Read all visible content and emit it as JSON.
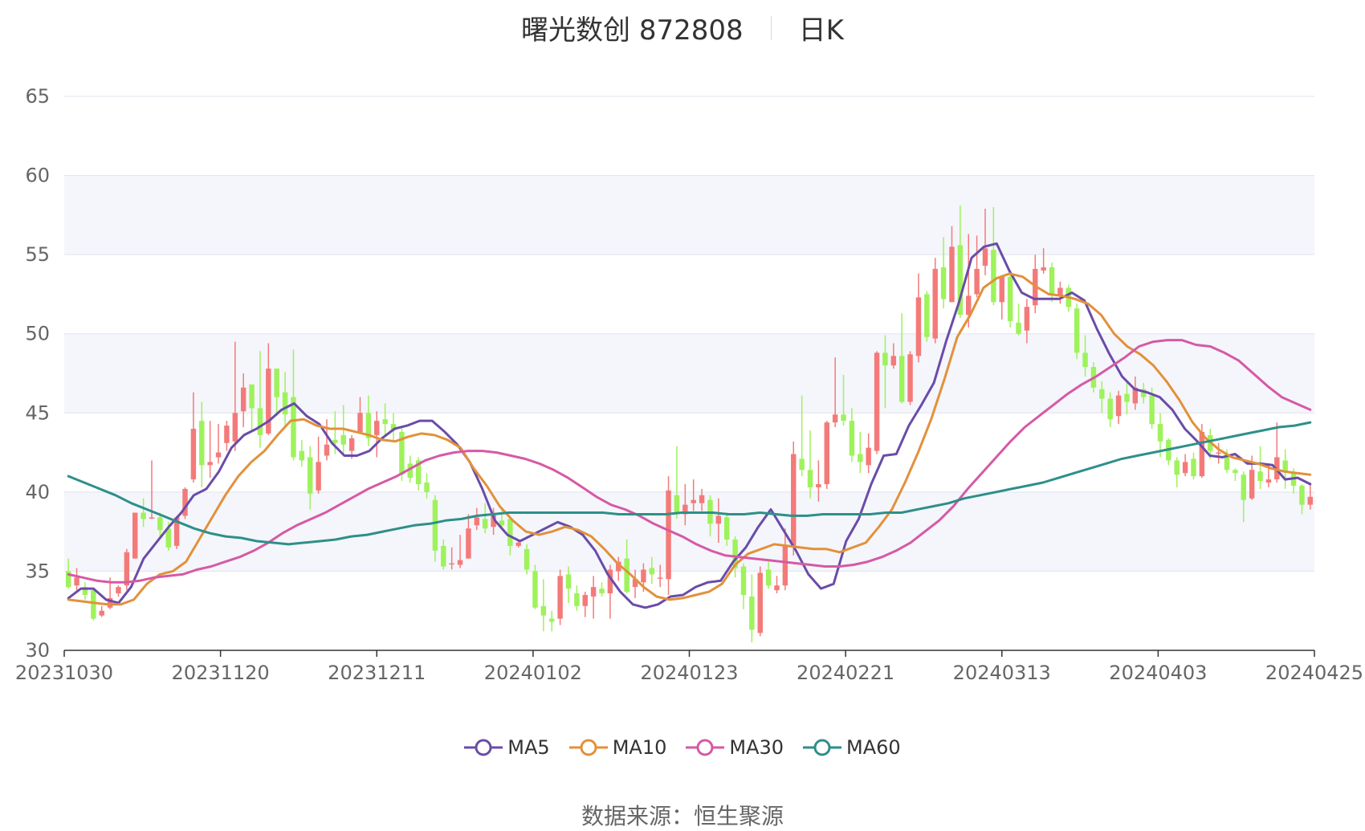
{
  "title": {
    "name": "曙光数创 872808",
    "period": "日K"
  },
  "source": {
    "label": "数据来源：",
    "value": "恒生聚源"
  },
  "colors": {
    "up": "#f47a7a",
    "down": "#9ef25b",
    "MA5": "#6a4ca8",
    "MA10": "#e2913b",
    "MA30": "#d659a5",
    "MA60": "#2e8f8a",
    "band": "#f4f6fb",
    "grid": "#dfe3ee"
  },
  "chart_data": {
    "type": "candlestick",
    "x_ticks": [
      "20231030",
      "20231120",
      "20231211",
      "20240102",
      "20240123",
      "20240221",
      "20240313",
      "20240403",
      "20240425"
    ],
    "ylim": [
      30,
      65
    ],
    "y_ticks": [
      30,
      35,
      40,
      45,
      50,
      55,
      60,
      65
    ],
    "grid": true,
    "legend_position": "bottom",
    "series": [
      {
        "name": "MA5",
        "color": "#6a4ca8",
        "values": [
          33.3,
          33.9,
          33.9,
          33.2,
          33.0,
          34.0,
          35.8,
          36.8,
          37.8,
          38.7,
          39.8,
          40.2,
          41.3,
          42.8,
          43.6,
          44.0,
          44.5,
          45.2,
          45.6,
          44.8,
          44.3,
          43.1,
          42.3,
          42.3,
          42.6,
          43.4,
          44.0,
          44.2,
          44.5,
          44.5,
          43.8,
          43.0,
          41.9,
          40.2,
          38.2,
          37.3,
          36.9,
          37.3,
          37.7,
          38.1,
          37.8,
          37.3,
          36.3,
          34.8,
          33.7,
          32.9,
          32.7,
          32.9,
          33.4,
          33.5,
          34.0,
          34.3,
          34.4,
          35.6,
          36.5,
          37.8,
          38.9,
          37.6,
          36.3,
          34.8,
          33.9,
          34.2,
          36.9,
          38.3,
          40.5,
          42.3,
          42.4,
          44.2,
          45.5,
          46.9,
          49.6,
          52.0,
          54.8,
          55.5,
          55.7,
          54.0,
          52.6,
          52.2,
          52.2,
          52.2,
          52.6,
          52.1,
          50.3,
          48.7,
          47.3,
          46.5,
          46.3,
          46.0,
          45.2,
          44.0,
          43.2,
          42.3,
          42.2,
          42.4,
          41.8,
          41.8,
          41.7,
          40.8,
          40.9,
          40.5
        ]
      },
      {
        "name": "MA10",
        "color": "#e2913b",
        "values": [
          33.2,
          33.1,
          33.0,
          32.9,
          32.9,
          33.2,
          34.2,
          34.8,
          35.0,
          35.6,
          37.0,
          38.4,
          39.8,
          41.0,
          41.9,
          42.6,
          43.6,
          44.5,
          44.6,
          44.2,
          44.0,
          44.0,
          43.8,
          43.6,
          43.3,
          43.2,
          43.5,
          43.7,
          43.6,
          43.3,
          42.8,
          41.5,
          40.4,
          39.1,
          38.2,
          37.5,
          37.3,
          37.5,
          37.8,
          37.6,
          37.2,
          36.4,
          35.5,
          34.8,
          34.0,
          33.4,
          33.2,
          33.3,
          33.5,
          33.7,
          34.2,
          35.4,
          36.1,
          36.4,
          36.7,
          36.6,
          36.5,
          36.4,
          36.4,
          36.2,
          36.5,
          36.8,
          37.8,
          38.9,
          40.6,
          42.5,
          44.6,
          47.1,
          49.8,
          51.2,
          52.9,
          53.5,
          53.8,
          53.6,
          53.0,
          52.5,
          52.4,
          52.2,
          51.9,
          51.2,
          50.0,
          49.2,
          48.7,
          48.0,
          47.0,
          45.8,
          44.4,
          43.4,
          42.7,
          42.2,
          42.0,
          41.8,
          41.5,
          41.3,
          41.2,
          41.1
        ]
      },
      {
        "name": "MA30",
        "color": "#d659a5",
        "values": [
          34.8,
          34.6,
          34.4,
          34.3,
          34.3,
          34.4,
          34.6,
          34.7,
          34.8,
          35.1,
          35.3,
          35.6,
          35.9,
          36.3,
          36.8,
          37.4,
          37.9,
          38.3,
          38.7,
          39.2,
          39.7,
          40.2,
          40.6,
          41.0,
          41.5,
          42.0,
          42.3,
          42.5,
          42.6,
          42.6,
          42.5,
          42.3,
          42.1,
          41.8,
          41.4,
          40.9,
          40.3,
          39.7,
          39.2,
          38.9,
          38.5,
          38.0,
          37.6,
          37.2,
          36.7,
          36.3,
          36.0,
          35.9,
          35.8,
          35.7,
          35.6,
          35.5,
          35.4,
          35.3,
          35.3,
          35.4,
          35.6,
          35.9,
          36.3,
          36.8,
          37.5,
          38.2,
          39.1,
          40.2,
          41.2,
          42.2,
          43.2,
          44.1,
          44.8,
          45.5,
          46.2,
          46.8,
          47.3,
          47.9,
          48.5,
          49.2,
          49.5,
          49.6,
          49.6,
          49.3,
          49.2,
          48.8,
          48.3,
          47.5,
          46.7,
          46.0,
          45.6,
          45.2
        ]
      },
      {
        "name": "MA60",
        "color": "#2e8f8a",
        "values": [
          41.0,
          40.6,
          40.2,
          39.8,
          39.3,
          38.9,
          38.5,
          38.1,
          37.7,
          37.4,
          37.2,
          37.1,
          36.9,
          36.8,
          36.7,
          36.8,
          36.9,
          37.0,
          37.2,
          37.3,
          37.5,
          37.7,
          37.9,
          38.0,
          38.2,
          38.3,
          38.5,
          38.6,
          38.7,
          38.7,
          38.7,
          38.7,
          38.7,
          38.7,
          38.7,
          38.6,
          38.6,
          38.6,
          38.6,
          38.7,
          38.7,
          38.7,
          38.6,
          38.6,
          38.7,
          38.6,
          38.5,
          38.5,
          38.6,
          38.6,
          38.6,
          38.6,
          38.7,
          38.7,
          38.9,
          39.1,
          39.3,
          39.6,
          39.8,
          40.0,
          40.2,
          40.4,
          40.6,
          40.9,
          41.2,
          41.5,
          41.8,
          42.1,
          42.3,
          42.5,
          42.7,
          42.9,
          43.1,
          43.3,
          43.5,
          43.7,
          43.9,
          44.1,
          44.2,
          44.4
        ]
      }
    ],
    "candles": [
      [
        35.0,
        34.0,
        35.8,
        33.9
      ],
      [
        34.1,
        34.6,
        35.2,
        33.8
      ],
      [
        34.0,
        33.5,
        34.3,
        33.2
      ],
      [
        33.8,
        32.0,
        33.9,
        31.9
      ],
      [
        32.2,
        32.5,
        32.8,
        32.1
      ],
      [
        32.7,
        33.3,
        34.6,
        32.6
      ],
      [
        33.6,
        34.0,
        34.1,
        33.4
      ],
      [
        34.1,
        36.2,
        36.4,
        33.8
      ],
      [
        35.8,
        38.7,
        38.7,
        35.8
      ],
      [
        38.7,
        38.3,
        39.6,
        37.8
      ],
      [
        38.4,
        38.4,
        42.0,
        38.3
      ],
      [
        38.4,
        37.6,
        38.7,
        37.1
      ],
      [
        37.7,
        36.5,
        38.1,
        36.3
      ],
      [
        36.6,
        38.4,
        38.5,
        36.4
      ],
      [
        38.5,
        40.2,
        40.3,
        38.3
      ],
      [
        40.8,
        44.0,
        46.3,
        40.6
      ],
      [
        44.5,
        41.7,
        45.7,
        40.3
      ],
      [
        41.7,
        41.9,
        44.5,
        40.9
      ],
      [
        42.2,
        42.5,
        44.3,
        41.8
      ],
      [
        43.1,
        44.2,
        44.5,
        42.6
      ],
      [
        43.2,
        45.0,
        49.5,
        42.6
      ],
      [
        45.1,
        46.6,
        47.5,
        44.1
      ],
      [
        46.8,
        45.3,
        46.8,
        43.8
      ],
      [
        45.3,
        43.6,
        48.9,
        42.8
      ],
      [
        43.7,
        47.8,
        49.4,
        43.6
      ],
      [
        47.8,
        46.0,
        47.8,
        44.8
      ],
      [
        46.3,
        44.9,
        47.6,
        44.1
      ],
      [
        46.0,
        42.2,
        49.0,
        42.0
      ],
      [
        42.6,
        42.0,
        43.3,
        41.6
      ],
      [
        42.2,
        39.9,
        42.9,
        38.9
      ],
      [
        40.1,
        41.9,
        43.5,
        39.9
      ],
      [
        42.3,
        43.0,
        44.6,
        42.0
      ],
      [
        43.3,
        43.1,
        45.1,
        42.4
      ],
      [
        43.6,
        43.0,
        45.5,
        42.3
      ],
      [
        42.6,
        43.4,
        43.6,
        42.1
      ],
      [
        43.8,
        45.0,
        46.0,
        43.7
      ],
      [
        45.0,
        43.4,
        46.1,
        42.9
      ],
      [
        43.6,
        44.5,
        45.1,
        42.2
      ],
      [
        44.6,
        44.3,
        45.6,
        43.6
      ],
      [
        44.3,
        43.9,
        45.0,
        43.2
      ],
      [
        43.8,
        41.1,
        44.1,
        40.7
      ],
      [
        41.8,
        40.9,
        42.3,
        40.6
      ],
      [
        42.0,
        40.5,
        42.2,
        40.1
      ],
      [
        40.6,
        40.0,
        41.2,
        39.6
      ],
      [
        39.5,
        36.3,
        39.8,
        35.6
      ],
      [
        36.6,
        35.3,
        37.0,
        35.1
      ],
      [
        35.5,
        35.5,
        36.5,
        35.1
      ],
      [
        35.4,
        35.7,
        37.3,
        35.2
      ],
      [
        35.8,
        37.7,
        38.6,
        35.8
      ],
      [
        37.9,
        38.4,
        39.0,
        37.6
      ],
      [
        38.3,
        37.7,
        39.3,
        37.4
      ],
      [
        37.8,
        38.6,
        39.0,
        37.3
      ],
      [
        38.2,
        37.9,
        38.9,
        37.6
      ],
      [
        38.3,
        36.6,
        38.4,
        36.0
      ],
      [
        36.6,
        36.8,
        37.0,
        36.5
      ],
      [
        36.4,
        35.1,
        36.7,
        34.8
      ],
      [
        35.0,
        32.7,
        35.4,
        32.6
      ],
      [
        32.8,
        32.2,
        34.5,
        31.2
      ],
      [
        32.0,
        31.8,
        32.5,
        31.2
      ],
      [
        32.0,
        34.7,
        35.1,
        31.6
      ],
      [
        34.8,
        33.9,
        35.3,
        33.0
      ],
      [
        33.6,
        32.8,
        34.1,
        32.5
      ],
      [
        32.8,
        33.5,
        33.7,
        32.1
      ],
      [
        33.4,
        34.0,
        34.7,
        32.0
      ],
      [
        33.9,
        33.6,
        34.3,
        33.4
      ],
      [
        33.6,
        35.1,
        35.4,
        32.0
      ],
      [
        35.0,
        35.6,
        35.9,
        34.4
      ],
      [
        35.8,
        33.7,
        37.0,
        33.6
      ],
      [
        34.0,
        34.5,
        35.1,
        33.3
      ],
      [
        34.3,
        35.1,
        35.5,
        33.7
      ],
      [
        35.2,
        34.8,
        35.9,
        34.2
      ],
      [
        34.6,
        34.6,
        35.4,
        34.0
      ],
      [
        34.5,
        40.1,
        41.0,
        33.5
      ],
      [
        39.8,
        38.6,
        42.9,
        38.3
      ],
      [
        38.6,
        39.2,
        40.5,
        37.9
      ],
      [
        39.3,
        39.5,
        40.8,
        38.8
      ],
      [
        39.3,
        39.8,
        40.2,
        38.8
      ],
      [
        39.5,
        38.0,
        39.8,
        37.2
      ],
      [
        38.0,
        38.5,
        39.6,
        36.8
      ],
      [
        38.4,
        37.0,
        38.7,
        36.6
      ],
      [
        37.0,
        35.2,
        37.2,
        34.6
      ],
      [
        35.3,
        33.5,
        35.5,
        32.6
      ],
      [
        33.4,
        31.3,
        34.8,
        30.5
      ],
      [
        31.1,
        34.9,
        35.3,
        30.9
      ],
      [
        35.1,
        34.1,
        35.6,
        33.9
      ],
      [
        33.8,
        34.1,
        34.7,
        33.6
      ],
      [
        34.1,
        36.6,
        37.7,
        33.8
      ],
      [
        36.6,
        42.4,
        43.2,
        36.0
      ],
      [
        42.1,
        41.4,
        46.1,
        41.0
      ],
      [
        41.4,
        40.3,
        43.9,
        39.6
      ],
      [
        40.3,
        40.5,
        42.0,
        39.4
      ],
      [
        40.5,
        44.4,
        44.5,
        40.2
      ],
      [
        44.4,
        44.9,
        48.5,
        44.1
      ],
      [
        44.9,
        44.5,
        47.4,
        44.2
      ],
      [
        44.5,
        42.3,
        45.3,
        41.9
      ],
      [
        42.4,
        41.9,
        43.8,
        41.2
      ],
      [
        41.7,
        42.8,
        43.7,
        41.2
      ],
      [
        42.6,
        48.8,
        48.9,
        42.4
      ],
      [
        48.8,
        48.0,
        49.9,
        45.3
      ],
      [
        48.0,
        48.6,
        49.4,
        47.8
      ],
      [
        48.6,
        45.7,
        51.3,
        45.6
      ],
      [
        45.7,
        48.7,
        48.9,
        45.5
      ],
      [
        48.6,
        52.3,
        53.8,
        48.2
      ],
      [
        52.5,
        49.8,
        52.7,
        49.5
      ],
      [
        49.7,
        54.1,
        54.8,
        49.4
      ],
      [
        54.2,
        52.2,
        56.1,
        51.6
      ],
      [
        52.0,
        55.5,
        56.8,
        52.0
      ],
      [
        55.6,
        51.2,
        58.1,
        51.0
      ],
      [
        51.2,
        52.4,
        56.3,
        50.4
      ],
      [
        52.5,
        54.1,
        56.2,
        52.3
      ],
      [
        54.3,
        55.4,
        57.9,
        53.7
      ],
      [
        55.3,
        52.0,
        58.0,
        51.8
      ],
      [
        52.0,
        53.6,
        53.7,
        50.9
      ],
      [
        53.6,
        50.8,
        53.9,
        50.4
      ],
      [
        50.7,
        50.0,
        51.9,
        49.9
      ],
      [
        50.2,
        51.7,
        52.2,
        49.4
      ],
      [
        51.8,
        54.1,
        55.0,
        51.3
      ],
      [
        54.0,
        54.2,
        55.4,
        53.8
      ],
      [
        54.2,
        52.5,
        54.5,
        52.0
      ],
      [
        52.4,
        52.9,
        53.3,
        51.9
      ],
      [
        52.9,
        51.7,
        53.1,
        51.4
      ],
      [
        51.6,
        48.8,
        51.9,
        48.4
      ],
      [
        48.8,
        47.9,
        49.9,
        47.3
      ],
      [
        47.9,
        46.6,
        48.2,
        46.3
      ],
      [
        46.5,
        45.9,
        47.0,
        45.0
      ],
      [
        45.9,
        44.6,
        46.3,
        44.1
      ],
      [
        44.8,
        46.1,
        46.4,
        44.3
      ],
      [
        46.2,
        45.7,
        47.0,
        44.9
      ],
      [
        45.6,
        46.6,
        47.3,
        45.2
      ],
      [
        46.5,
        46.0,
        46.9,
        45.6
      ],
      [
        46.1,
        44.3,
        46.6,
        44.0
      ],
      [
        44.3,
        43.2,
        45.0,
        42.2
      ],
      [
        43.3,
        42.0,
        43.4,
        41.7
      ],
      [
        42.0,
        41.1,
        42.2,
        40.3
      ],
      [
        41.2,
        41.9,
        42.4,
        41.0
      ],
      [
        42.1,
        41.0,
        42.5,
        40.8
      ],
      [
        41.0,
        43.8,
        44.3,
        40.9
      ],
      [
        43.6,
        42.6,
        44.0,
        42.1
      ],
      [
        42.5,
        42.5,
        43.1,
        41.8
      ],
      [
        42.4,
        41.4,
        42.7,
        41.2
      ],
      [
        41.4,
        41.2,
        41.5,
        40.7
      ],
      [
        41.1,
        39.5,
        41.3,
        38.1
      ],
      [
        39.6,
        41.4,
        42.3,
        39.5
      ],
      [
        41.3,
        40.7,
        42.9,
        40.2
      ],
      [
        40.6,
        40.8,
        41.7,
        40.3
      ],
      [
        40.8,
        42.2,
        44.4,
        40.6
      ],
      [
        42.0,
        41.3,
        42.7,
        40.2
      ],
      [
        41.2,
        40.4,
        41.5,
        39.9
      ],
      [
        40.4,
        39.2,
        40.5,
        38.6
      ],
      [
        39.2,
        39.7,
        40.6,
        38.9
      ]
    ]
  }
}
